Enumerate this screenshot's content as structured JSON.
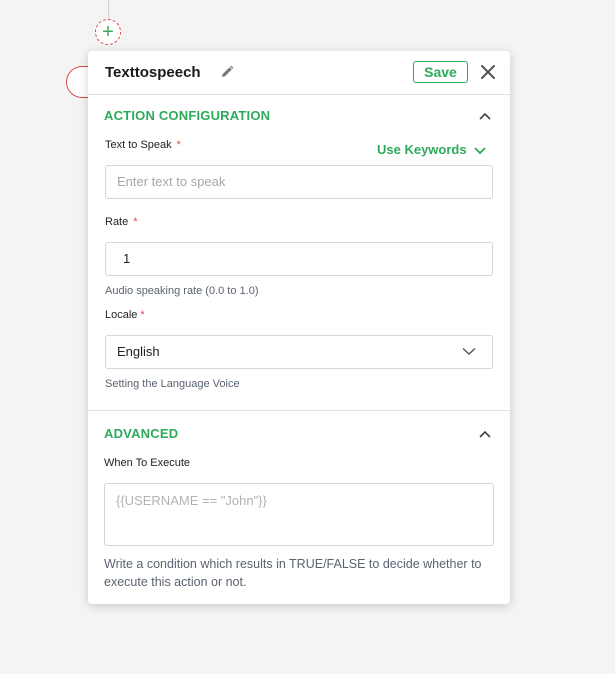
{
  "canvas": {
    "add_symbol": "+"
  },
  "panel": {
    "title": "Texttospeech",
    "save_label": "Save",
    "action_configuration": {
      "heading": "ACTION CONFIGURATION",
      "text_to_speak": {
        "label": "Text to Speak",
        "required_mark": "*",
        "use_keywords_label": "Use Keywords",
        "placeholder": "Enter text to speak",
        "value": ""
      },
      "rate": {
        "label": "Rate",
        "required_mark": "*",
        "value": "1",
        "helper": "Audio speaking rate (0.0 to 1.0)"
      },
      "locale": {
        "label": "Locale",
        "required_mark": "*",
        "selected": "English",
        "helper": "Setting the Language Voice"
      }
    },
    "advanced": {
      "heading": "ADVANCED",
      "when_to_execute": {
        "label": "When To Execute",
        "placeholder": "{{USERNAME == \"John\"}}",
        "helper": "Write a condition which results in TRUE/FALSE to decide whether to execute this action or not."
      }
    }
  },
  "colors": {
    "accent": "#2eaa5c",
    "required": "#e04848",
    "border": "#d6d6d6"
  },
  "icons": {
    "edit": "pencil-icon",
    "close": "close-icon",
    "collapse": "chevron-up-icon",
    "dropdown": "chevron-down-icon",
    "add": "plus-icon"
  }
}
